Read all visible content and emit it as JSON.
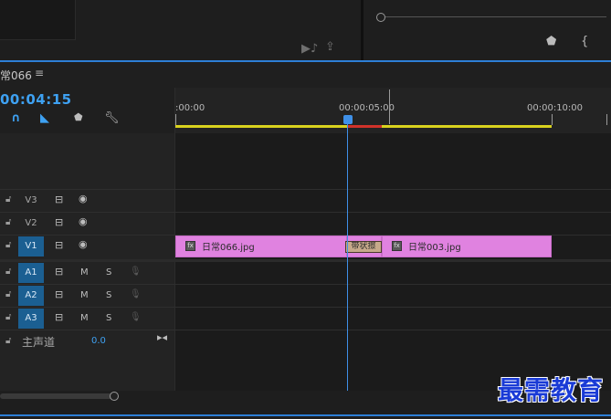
{
  "sequence": {
    "title": "常066",
    "menu_icon": "≡",
    "timecode": "00:04:15"
  },
  "toolbar": {
    "snap_icon": "snap-magnet-icon",
    "linked_icon": "linked-selection-icon",
    "marker_icon": "marker-icon",
    "settings_icon": "wrench-icon"
  },
  "ruler": {
    "labels": [
      ":00:00",
      "00:00:05:00",
      "00:00:10:00"
    ]
  },
  "tracks": [
    {
      "name": "V3",
      "type": "video",
      "active": false
    },
    {
      "name": "V2",
      "type": "video",
      "active": false
    },
    {
      "name": "V1",
      "type": "video",
      "active": true
    },
    {
      "name": "A1",
      "type": "audio",
      "active": true
    },
    {
      "name": "A2",
      "type": "audio",
      "active": true
    },
    {
      "name": "A3",
      "type": "audio",
      "active": true
    }
  ],
  "audio_buttons": {
    "mute": "M",
    "solo": "S"
  },
  "clips": [
    {
      "name": "日常066.jpg",
      "track": "V1"
    },
    {
      "name": "日常003.jpg",
      "track": "V1"
    }
  ],
  "transition_label": "带状擦",
  "master": {
    "label": "主声道",
    "value": "0.0"
  },
  "watermark": "最需教育",
  "colors": {
    "accent_blue": "#2d7fd6",
    "clip_pink": "#e082e0",
    "track_active": "#1b5f92",
    "workarea_yellow": "#d9d21e",
    "render_red": "#d0322a"
  }
}
